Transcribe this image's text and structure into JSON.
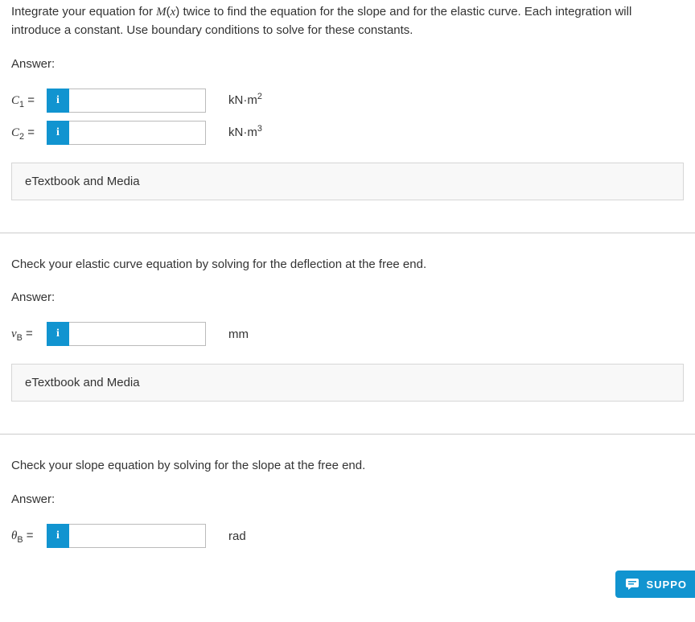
{
  "part1": {
    "instructions": "Integrate your equation for M(x) twice to find the equation for the slope and for the elastic curve. Each integration will introduce a constant. Use boundary conditions to solve for these constants.",
    "answer_label": "Answer:",
    "rows": [
      {
        "var_base": "C",
        "var_sub": "1",
        "eq": " = ",
        "info": "i",
        "value": "",
        "unit_base": "kN·m",
        "unit_sup": "2"
      },
      {
        "var_base": "C",
        "var_sub": "2",
        "eq": " = ",
        "info": "i",
        "value": "",
        "unit_base": "kN·m",
        "unit_sup": "3"
      }
    ],
    "media_label": "eTextbook and Media"
  },
  "part2": {
    "instructions": "Check your elastic curve equation by solving for the deflection at the free end.",
    "answer_label": "Answer:",
    "rows": [
      {
        "var_base": "v",
        "var_sub": "B",
        "eq": " = ",
        "info": "i",
        "value": "",
        "unit": "mm"
      }
    ],
    "media_label": "eTextbook and Media"
  },
  "part3": {
    "instructions": "Check your slope equation by solving for the slope at the free end.",
    "answer_label": "Answer:",
    "rows": [
      {
        "var_base": "θ",
        "var_sub": "B",
        "eq": " = ",
        "info": "i",
        "value": "",
        "unit": "rad"
      }
    ]
  },
  "support": {
    "label": "SUPPO"
  }
}
